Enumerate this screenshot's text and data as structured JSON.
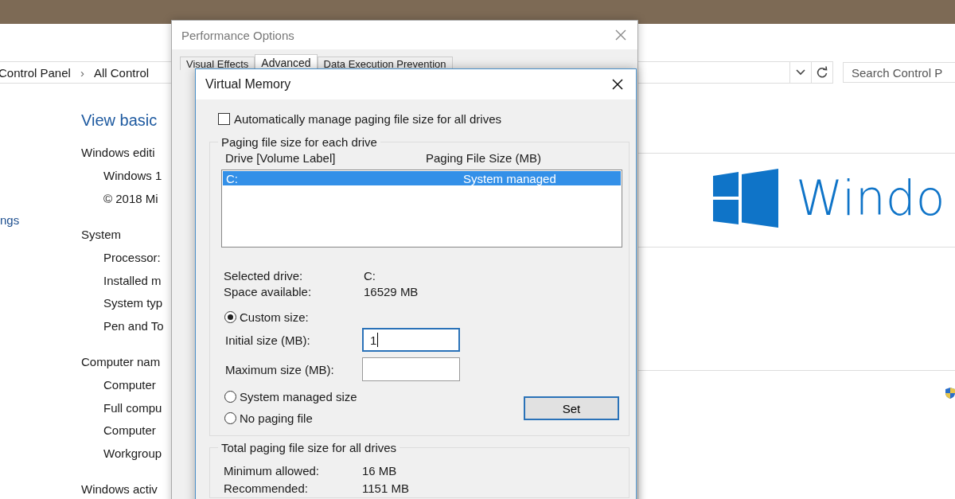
{
  "control_panel": {
    "breadcrumb": [
      {
        "kind": "item",
        "text": "Control Panel"
      },
      {
        "kind": "separator",
        "text": "›"
      },
      {
        "kind": "item",
        "text": "All Control"
      }
    ],
    "search": {
      "placeholder": "Search Control P"
    },
    "sidebar_link": "ngs",
    "heading": "View basic",
    "sections": [
      {
        "title": "Windows editi",
        "items": [
          "Windows 1",
          "© 2018 Mi"
        ]
      },
      {
        "title": "System",
        "items": [
          "Processor:",
          "Installed m",
          "System typ",
          "Pen and To"
        ]
      },
      {
        "title": "Computer nam",
        "items": [
          "Computer",
          "Full compu",
          "Computer",
          "Workgroup"
        ]
      },
      {
        "title": "Windows activ"
      }
    ],
    "logo_text": "Windo"
  },
  "performance_options": {
    "title": "Performance Options",
    "tabs": [
      {
        "label": "Visual Effects",
        "selected": false
      },
      {
        "label": "Advanced",
        "selected": true
      },
      {
        "label": "Data Execution Prevention",
        "selected": false
      }
    ]
  },
  "virtual_memory": {
    "title": "Virtual Memory",
    "auto_manage": {
      "label": "Automatically manage paging file size for all drives",
      "checked": false
    },
    "drive_group": {
      "title": "Paging file size for each drive",
      "columns": [
        "Drive  [Volume Label]",
        "Paging File Size (MB)"
      ],
      "drives": [
        {
          "drive": "C:",
          "size": "System managed",
          "selected": true
        }
      ],
      "info": [
        {
          "label": "Selected drive:",
          "value": "C:"
        },
        {
          "label": "Space available:",
          "value": "16529 MB"
        }
      ],
      "options": [
        {
          "label": "Custom size:",
          "selected": true
        },
        {
          "label": "System managed size",
          "selected": false
        },
        {
          "label": "No paging file",
          "selected": false
        }
      ],
      "fields": [
        {
          "label": "Initial size (MB):",
          "value": "1",
          "focused": true
        },
        {
          "label": "Maximum size (MB):",
          "focused": false
        }
      ],
      "set_button": "Set"
    },
    "total_group": {
      "title": "Total paging file size for all drives",
      "rows": [
        {
          "label": "Minimum allowed:",
          "value": "16 MB"
        },
        {
          "label": "Recommended:",
          "value": "1151 MB"
        }
      ]
    }
  }
}
